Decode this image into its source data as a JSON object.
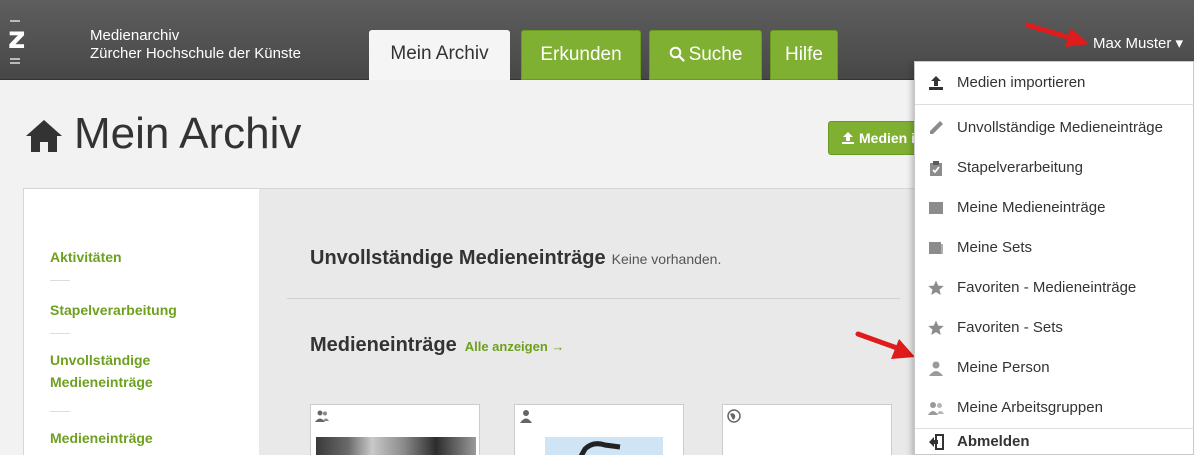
{
  "header": {
    "app_name": "Medienarchiv",
    "institution": "Zürcher Hochschule der Künste",
    "tabs": [
      {
        "label": "Mein Archiv"
      },
      {
        "label": "Erkunden"
      },
      {
        "label": "Suche"
      },
      {
        "label": "Hilfe"
      }
    ],
    "user_label": "Max Muster ▾"
  },
  "page": {
    "title": "Mein Archiv",
    "import_button": "Medien importieren"
  },
  "sidebar": {
    "items": [
      {
        "label": "Aktivitäten"
      },
      {
        "label": "Stapelverarbeitung"
      },
      {
        "label": "Unvollständige Medieneinträge"
      },
      {
        "label": "Medieneinträge"
      }
    ]
  },
  "main": {
    "incomplete_title": "Unvollständige Medieneinträge",
    "incomplete_note": "Keine vorhanden.",
    "entries_title": "Medieneinträge",
    "entries_link": "Alle anzeigen →"
  },
  "dropdown": {
    "items": [
      {
        "label": "Medien importieren",
        "icon": "upload-icon"
      },
      {
        "label": "Unvollständige Medieneinträge",
        "icon": "pencil-icon"
      },
      {
        "label": "Stapelverarbeitung",
        "icon": "clipboard-icon"
      },
      {
        "label": "Meine Medieneinträge",
        "icon": "square-icon"
      },
      {
        "label": "Meine Sets",
        "icon": "set-icon"
      },
      {
        "label": "Favoriten - Medieneinträge",
        "icon": "star-icon"
      },
      {
        "label": "Favoriten - Sets",
        "icon": "star-icon"
      },
      {
        "label": "Meine Person",
        "icon": "person-icon"
      },
      {
        "label": "Meine Arbeitsgruppen",
        "icon": "group-icon"
      },
      {
        "label": "Abmelden",
        "icon": "logout-icon"
      }
    ]
  },
  "colors": {
    "accent_green": "#7fb031",
    "link_green": "#6ea020",
    "header_bg": "#505050",
    "annotation_red": "#e01b1b"
  }
}
